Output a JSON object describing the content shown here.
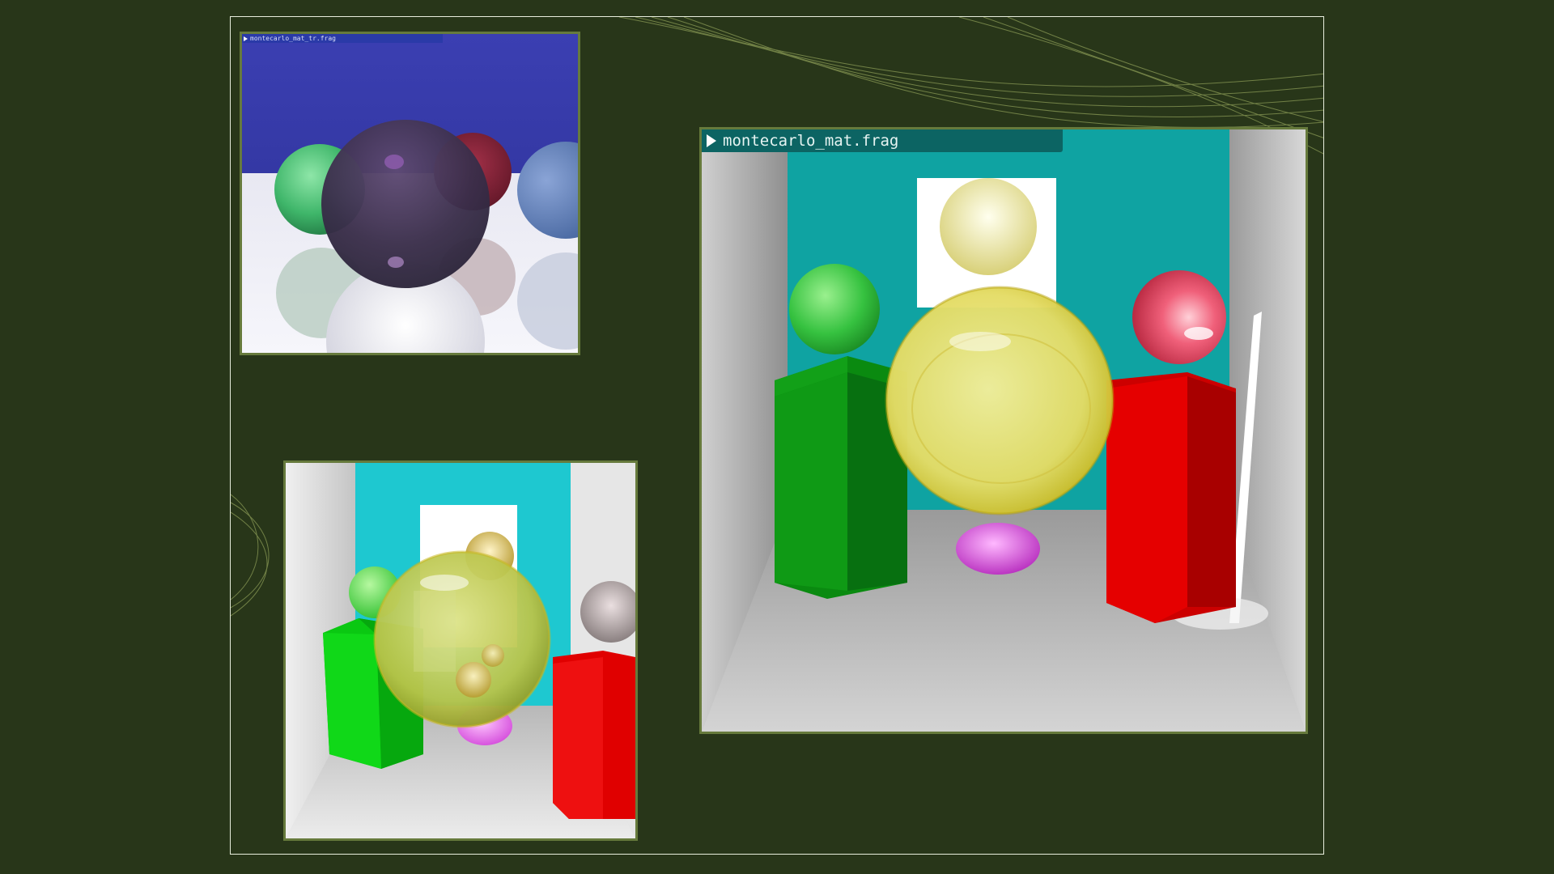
{
  "panels": {
    "top_left": {
      "window_title": "montecarlo_mat_tr.frag"
    },
    "right": {
      "window_title": "montecarlo_mat.frag"
    },
    "bottom_left": {
      "window_title": ""
    }
  },
  "colors": {
    "background": "#283619",
    "panel_border": "#667a3c",
    "title_bar": "#0c6463",
    "sky_blue": "#3d3fb0",
    "teal_wall": "#0fa8a6",
    "cyan_wall": "#1ec9d1",
    "green_box": "#0e9a14",
    "red_box": "#e00000"
  },
  "icons": [
    "play-icon"
  ]
}
